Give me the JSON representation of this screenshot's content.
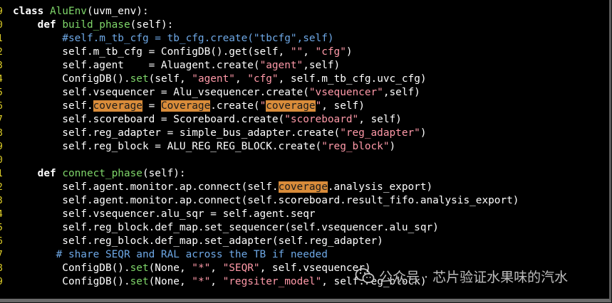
{
  "editor": {
    "lines": [
      {
        "n": "9",
        "segs": [
          {
            "t": "class ",
            "c": "kw"
          },
          {
            "t": "AluEnv",
            "c": "fn"
          },
          {
            "t": "(uvm_env):",
            "c": ""
          }
        ]
      },
      {
        "n": "0",
        "segs": [
          {
            "t": "    ",
            "c": ""
          },
          {
            "t": "def ",
            "c": "kw"
          },
          {
            "t": "build_phase",
            "c": "fn"
          },
          {
            "t": "(self):",
            "c": ""
          }
        ]
      },
      {
        "n": "1",
        "segs": [
          {
            "t": "        #self.m_tb_cfg = tb_cfg.create(\"tbcfg\",self)",
            "c": "cm"
          }
        ]
      },
      {
        "n": "2",
        "segs": [
          {
            "t": "        self.m_tb_cfg = ConfigDB().get(self, ",
            "c": ""
          },
          {
            "t": "\"\"",
            "c": "st"
          },
          {
            "t": ", ",
            "c": ""
          },
          {
            "t": "\"cfg\"",
            "c": "st"
          },
          {
            "t": ")",
            "c": ""
          }
        ]
      },
      {
        "n": "3",
        "segs": [
          {
            "t": "        self.agent    = Aluagent.create(",
            "c": ""
          },
          {
            "t": "\"agent\"",
            "c": "st"
          },
          {
            "t": ",self)",
            "c": ""
          }
        ]
      },
      {
        "n": "4",
        "segs": [
          {
            "t": "        ConfigDB().",
            "c": ""
          },
          {
            "t": "set",
            "c": "fn"
          },
          {
            "t": "(self, ",
            "c": ""
          },
          {
            "t": "\"agent\"",
            "c": "st"
          },
          {
            "t": ", ",
            "c": ""
          },
          {
            "t": "\"cfg\"",
            "c": "st"
          },
          {
            "t": ", self.m_tb_cfg.uvc_cfg)",
            "c": ""
          }
        ]
      },
      {
        "n": "5",
        "segs": [
          {
            "t": "        self.vsequencer = Alu_vsequencer.create(",
            "c": ""
          },
          {
            "t": "\"vsequencer\"",
            "c": "st"
          },
          {
            "t": ",self)",
            "c": ""
          }
        ]
      },
      {
        "n": "6",
        "segs": [
          {
            "t": "        self.",
            "c": ""
          },
          {
            "t": "coverage",
            "c": "hl"
          },
          {
            "t": " = ",
            "c": ""
          },
          {
            "t": "Coverage",
            "c": "hl"
          },
          {
            "t": ".create(",
            "c": ""
          },
          {
            "t": "\"",
            "c": "st"
          },
          {
            "t": "coverage",
            "c": "hl"
          },
          {
            "t": "\"",
            "c": "st"
          },
          {
            "t": ", self)",
            "c": ""
          }
        ]
      },
      {
        "n": "7",
        "segs": [
          {
            "t": "        self.scoreboard = Scoreboard.create(",
            "c": ""
          },
          {
            "t": "\"scoreboard\"",
            "c": "st"
          },
          {
            "t": ", self)",
            "c": ""
          }
        ]
      },
      {
        "n": "8",
        "segs": [
          {
            "t": "        self.reg_adapter = simple_bus_adapter.create(",
            "c": ""
          },
          {
            "t": "\"reg_adapter\"",
            "c": "st"
          },
          {
            "t": ")",
            "c": ""
          }
        ]
      },
      {
        "n": "9",
        "segs": [
          {
            "t": "        self.reg_block = ALU_REG_REG_BLOCK.create(",
            "c": ""
          },
          {
            "t": "\"reg_block\"",
            "c": "st"
          },
          {
            "t": ")",
            "c": ""
          }
        ]
      },
      {
        "n": "0",
        "segs": []
      },
      {
        "n": "1",
        "segs": [
          {
            "t": "    ",
            "c": ""
          },
          {
            "t": "def ",
            "c": "kw"
          },
          {
            "t": "connect_phase",
            "c": "fn"
          },
          {
            "t": "(self):",
            "c": ""
          }
        ]
      },
      {
        "n": "2",
        "segs": [
          {
            "t": "        self.agent.monitor.ap.connect(self.",
            "c": ""
          },
          {
            "t": "coverage",
            "c": "hl"
          },
          {
            "t": ".analysis_export)",
            "c": ""
          }
        ]
      },
      {
        "n": "3",
        "segs": [
          {
            "t": "        self.agent.monitor.ap.connect(self.scoreboard.result_fifo.analysis_export)",
            "c": ""
          }
        ]
      },
      {
        "n": "4",
        "segs": [
          {
            "t": "        self.vsequencer.alu_sqr = self.agent.seqr",
            "c": ""
          }
        ]
      },
      {
        "n": "5",
        "segs": [
          {
            "t": "        self.reg_block.def_map.set_sequencer(self.vsequencer.alu_sqr)",
            "c": ""
          }
        ]
      },
      {
        "n": "6",
        "segs": [
          {
            "t": "        self.reg_block.def_map.set_adapter(self.reg_adapter)",
            "c": ""
          }
        ]
      },
      {
        "n": "7",
        "segs": [
          {
            "t": "       # share SEQR and RAL across the TB if needed",
            "c": "cm"
          }
        ]
      },
      {
        "n": "8",
        "segs": [
          {
            "t": "        ConfigDB().",
            "c": ""
          },
          {
            "t": "set",
            "c": "fn"
          },
          {
            "t": "(None, ",
            "c": ""
          },
          {
            "t": "\"*\"",
            "c": "st"
          },
          {
            "t": ", ",
            "c": ""
          },
          {
            "t": "\"SEQR\"",
            "c": "st"
          },
          {
            "t": ", self.vsequencer)",
            "c": ""
          }
        ]
      },
      {
        "n": "9",
        "segs": [
          {
            "t": "        ConfigDB().",
            "c": ""
          },
          {
            "t": "set",
            "c": "fn"
          },
          {
            "t": "(None, ",
            "c": ""
          },
          {
            "t": "\"*\"",
            "c": "st"
          },
          {
            "t": ", ",
            "c": ""
          },
          {
            "t": "\"regsiter_model\"",
            "c": "st"
          },
          {
            "t": ", self.reg_block)",
            "c": ""
          }
        ]
      }
    ]
  },
  "watermark": {
    "text": "公众号 · 芯片验证水果味的汽水",
    "icon": "wechat-icon"
  },
  "colors": {
    "background": "#000000",
    "keyword": "#ffffff",
    "function": "#7fd66a",
    "string": "#ff99a8",
    "comment": "#6ea8e6",
    "highlight": "#d98c3a",
    "line_number": "#e0d028"
  }
}
